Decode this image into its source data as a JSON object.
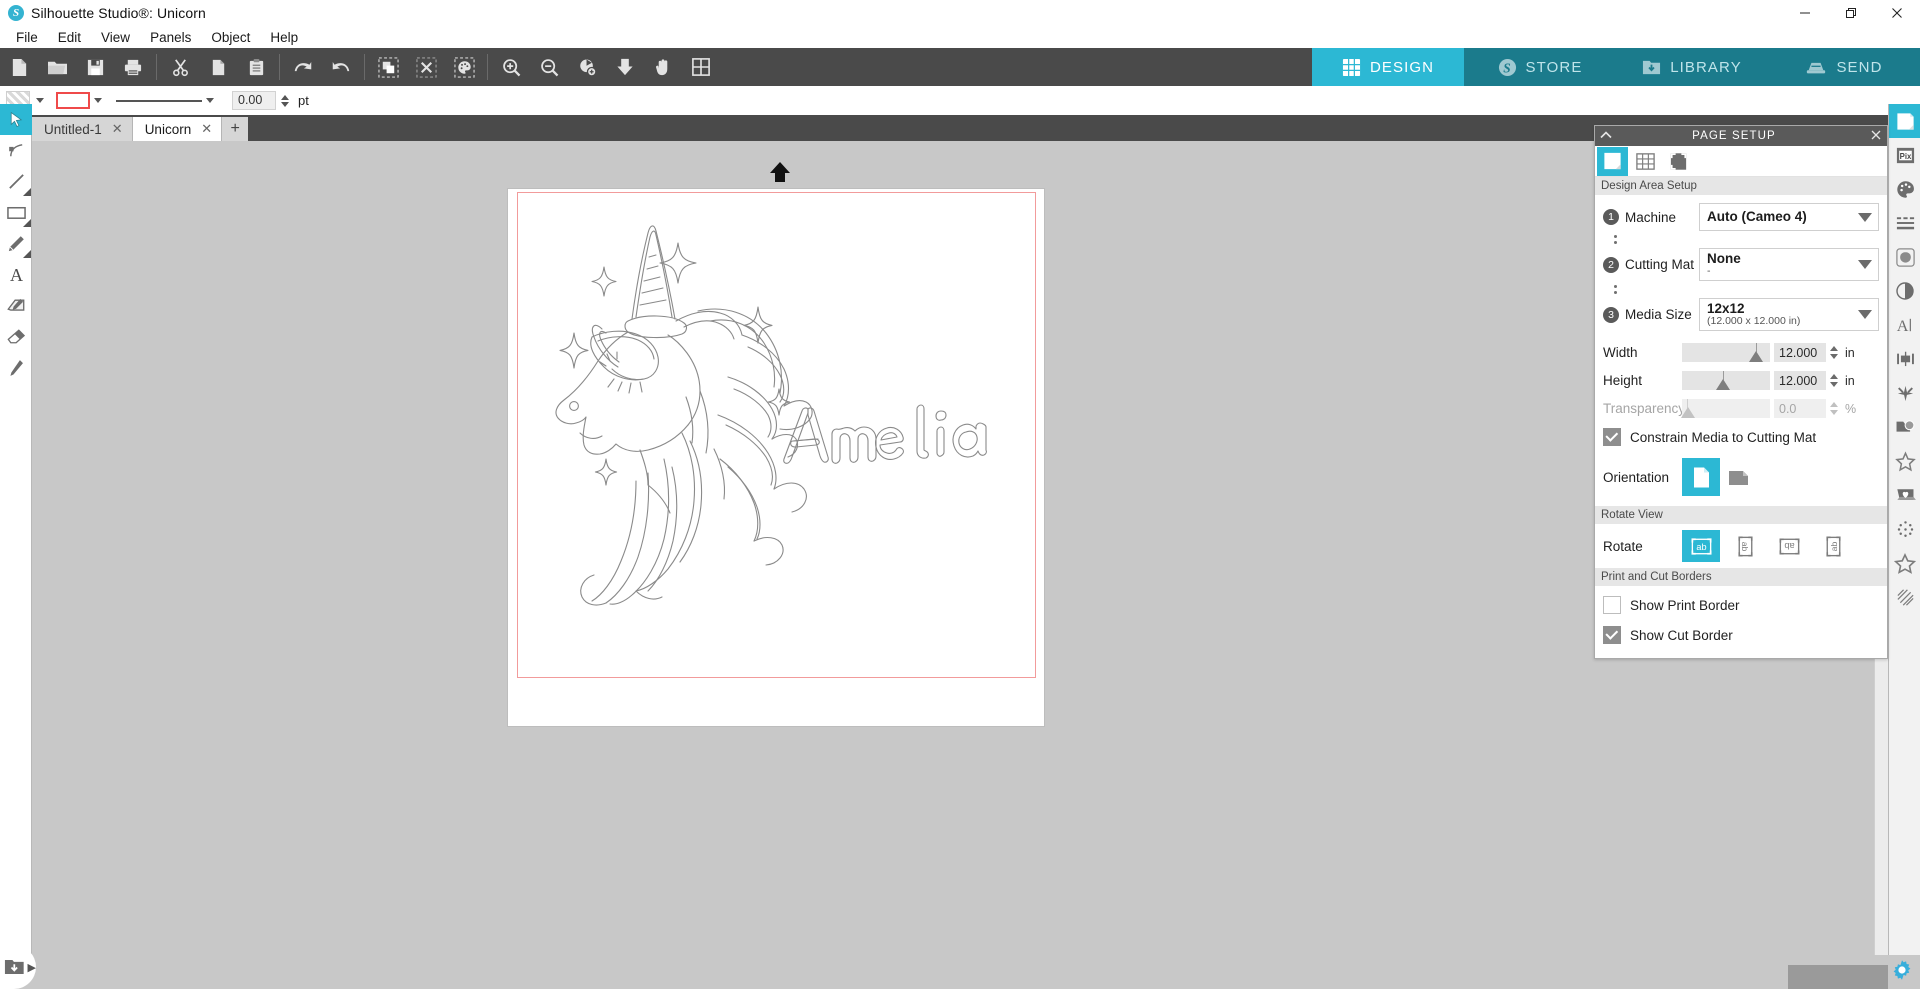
{
  "window": {
    "title": "Silhouette Studio®: Unicorn",
    "logo_icon": "silhouette-logo-icon",
    "minimize_label": "—",
    "maximize_label": "❐",
    "close_label": "✕"
  },
  "menubar": {
    "items": [
      {
        "label": "File"
      },
      {
        "label": "Edit"
      },
      {
        "label": "View"
      },
      {
        "label": "Panels"
      },
      {
        "label": "Object"
      },
      {
        "label": "Help"
      }
    ]
  },
  "toolbar": {
    "buttons": [
      {
        "name": "new-document-button",
        "icon": "new-document-icon",
        "tooltip": "New"
      },
      {
        "name": "open-button",
        "icon": "open-folder-icon",
        "tooltip": "Open"
      },
      {
        "name": "save-button",
        "icon": "save-disk-icon",
        "tooltip": "Save"
      },
      {
        "name": "print-button",
        "icon": "printer-icon",
        "tooltip": "Print"
      },
      {
        "name": "cut-button",
        "icon": "scissors-icon",
        "tooltip": "Cut"
      },
      {
        "name": "copy-button",
        "icon": "copy-icon",
        "tooltip": "Copy"
      },
      {
        "name": "paste-button",
        "icon": "clipboard-paste-icon",
        "tooltip": "Paste"
      },
      {
        "name": "undo-button",
        "icon": "undo-arrow-icon",
        "tooltip": "Undo"
      },
      {
        "name": "redo-button",
        "icon": "redo-arrow-icon",
        "tooltip": "Redo"
      },
      {
        "name": "select-all-button",
        "icon": "select-all-icon",
        "tooltip": "Select All"
      },
      {
        "name": "deselect-all-button",
        "icon": "deselect-all-icon",
        "tooltip": "Deselect All"
      },
      {
        "name": "select-by-color-button",
        "icon": "palette-select-icon",
        "tooltip": "Select by Color"
      },
      {
        "name": "zoom-in-button",
        "icon": "zoom-in-icon",
        "tooltip": "Zoom In"
      },
      {
        "name": "zoom-out-button",
        "icon": "zoom-out-icon",
        "tooltip": "Zoom Out"
      },
      {
        "name": "zoom-selection-button",
        "icon": "zoom-selection-icon",
        "tooltip": "Zoom to Selection"
      },
      {
        "name": "fit-to-window-button",
        "icon": "fit-window-icon",
        "tooltip": "Fit to Window"
      },
      {
        "name": "pan-button",
        "icon": "hand-pan-icon",
        "tooltip": "Pan"
      },
      {
        "name": "fit-page-button",
        "icon": "fit-page-icon",
        "tooltip": "Fit Page"
      }
    ],
    "modes": [
      {
        "label": "DESIGN",
        "icon": "grid-icon",
        "active": true
      },
      {
        "label": "STORE",
        "icon": "store-s-icon",
        "active": false
      },
      {
        "label": "LIBRARY",
        "icon": "library-folder-icon",
        "active": false
      },
      {
        "label": "SEND",
        "icon": "send-machine-icon",
        "active": false
      }
    ]
  },
  "propertybar": {
    "fill_swatch_name": "fill-none-swatch",
    "fill_dropdown": "▾",
    "line_color_value": "#ef4a4a",
    "line_dropdown": "▾",
    "stroke_style_dropdown": "▾",
    "line_weight_value": "0.00",
    "line_weight_unit": "pt"
  },
  "document_tabs": {
    "tabs": [
      {
        "label": "Untitled-1",
        "close": "✕",
        "active": false
      },
      {
        "label": "Unicorn",
        "close": "✕",
        "active": true
      }
    ],
    "add_label": "+"
  },
  "left_tools": [
    {
      "name": "select-tool",
      "icon": "arrow-cursor-icon",
      "active": true,
      "has_flyout": false
    },
    {
      "name": "edit-points-tool",
      "icon": "edit-points-icon",
      "active": false,
      "has_flyout": false
    },
    {
      "name": "line-tool",
      "icon": "line-icon",
      "active": false,
      "has_flyout": true
    },
    {
      "name": "rectangle-tool",
      "icon": "rectangle-icon",
      "active": false,
      "has_flyout": true
    },
    {
      "name": "draw-tool",
      "icon": "pencil-icon",
      "active": false,
      "has_flyout": true
    },
    {
      "name": "text-tool",
      "icon": "text-a-icon",
      "active": false,
      "has_flyout": false
    },
    {
      "name": "knife-tool",
      "icon": "note-pen-icon",
      "active": false,
      "has_flyout": false
    },
    {
      "name": "eraser-tool",
      "icon": "eraser-icon",
      "active": false,
      "has_flyout": false
    },
    {
      "name": "sketch-pen-tool",
      "icon": "marker-pen-icon",
      "active": false,
      "has_flyout": false
    }
  ],
  "right_rail": [
    {
      "name": "page-setup-panel-button",
      "icon": "page-setup-icon",
      "active": true
    },
    {
      "name": "pixscan-panel-button",
      "icon": "pixscan-icon",
      "active": false
    },
    {
      "name": "fill-panel-button",
      "icon": "palette-icon",
      "active": false
    },
    {
      "name": "line-style-panel-button",
      "icon": "line-style-icon",
      "active": false
    },
    {
      "name": "trace-panel-button",
      "icon": "trace-icon",
      "active": false
    },
    {
      "name": "offset-panel-button",
      "icon": "contrast-circle-icon",
      "active": false
    },
    {
      "name": "text-style-panel-button",
      "icon": "text-cursor-icon",
      "active": false
    },
    {
      "name": "transform-panel-button",
      "icon": "transform-align-icon",
      "active": false
    },
    {
      "name": "modify-panel-button",
      "icon": "modify-star-icon",
      "active": false
    },
    {
      "name": "replicate-panel-button",
      "icon": "replicate-icon",
      "active": false
    },
    {
      "name": "shapes-panel-button",
      "icon": "star-outline-icon",
      "active": false
    },
    {
      "name": "library-panel-button",
      "icon": "library-heart-icon",
      "active": false
    },
    {
      "name": "stipple-panel-button",
      "icon": "stipple-dots-icon",
      "active": false
    },
    {
      "name": "design-store-panel-button",
      "icon": "star-shape-icon",
      "active": false
    },
    {
      "name": "sketch-panel-button",
      "icon": "hatch-fill-icon",
      "active": false
    }
  ],
  "page_setup": {
    "title": "PAGE SETUP",
    "collapse_icon": "chevron-up-icon",
    "close_icon": "close-icon",
    "tabs": [
      {
        "name": "page-tab",
        "icon": "page-icon",
        "active": true
      },
      {
        "name": "grid-tab",
        "icon": "grid-tab-icon",
        "active": false
      },
      {
        "name": "marks-tab",
        "icon": "reg-marks-icon",
        "active": false
      }
    ],
    "section_design_area": "Design Area Setup",
    "machine": {
      "step": "1",
      "label": "Machine",
      "value": "Auto (Cameo 4)"
    },
    "cutting_mat": {
      "step": "2",
      "label": "Cutting Mat",
      "value": "None",
      "sub": "-"
    },
    "media_size": {
      "step": "3",
      "label": "Media Size",
      "value": "12x12",
      "sub": "(12.000 x 12.000 in)"
    },
    "width": {
      "label": "Width",
      "value": "12.000",
      "unit": "in"
    },
    "height": {
      "label": "Height",
      "value": "12.000",
      "unit": "in"
    },
    "transparency": {
      "label": "Transparency",
      "value": "0.0",
      "unit": "%"
    },
    "constrain": {
      "label": "Constrain Media to Cutting Mat",
      "checked": true
    },
    "orientation": {
      "label": "Orientation",
      "options": [
        {
          "name": "orientation-portrait-button",
          "icon": "portrait-page-icon",
          "active": true
        },
        {
          "name": "orientation-landscape-button",
          "icon": "landscape-page-icon",
          "active": false
        }
      ]
    },
    "section_rotate_view": "Rotate View",
    "rotate": {
      "label": "Rotate",
      "options": [
        {
          "name": "rotate-0-button",
          "glyph": "ab",
          "active": true,
          "rot": 0
        },
        {
          "name": "rotate-90-button",
          "glyph": "ab",
          "active": false,
          "rot": 90
        },
        {
          "name": "rotate-180-button",
          "glyph": "ab",
          "active": false,
          "rot": 180
        },
        {
          "name": "rotate-270-button",
          "glyph": "ab",
          "active": false,
          "rot": 270
        }
      ]
    },
    "section_print_cut": "Print and Cut Borders",
    "show_print_border": {
      "label": "Show Print Border",
      "checked": false
    },
    "show_cut_border": {
      "label": "Show Cut Border",
      "checked": true
    }
  },
  "canvas": {
    "artwork_name": "unicorn-amelia-design",
    "artwork_text": "Amelia",
    "cut_border_color": "#f29b9b",
    "page_color": "#ffffff",
    "background_color": "#c8c8c8",
    "top_arrow_icon": "media-feed-arrow-icon"
  },
  "bottom": {
    "library_fab_icon": "library-download-icon",
    "library_fab_arrow": "▶",
    "gear_icon": "gear-icon"
  },
  "colors": {
    "accent": "#2cb8d4",
    "mode_bar": "#1b7b8c",
    "toolbar": "#4a4a4a",
    "panel_header": "#5a5a5a"
  }
}
